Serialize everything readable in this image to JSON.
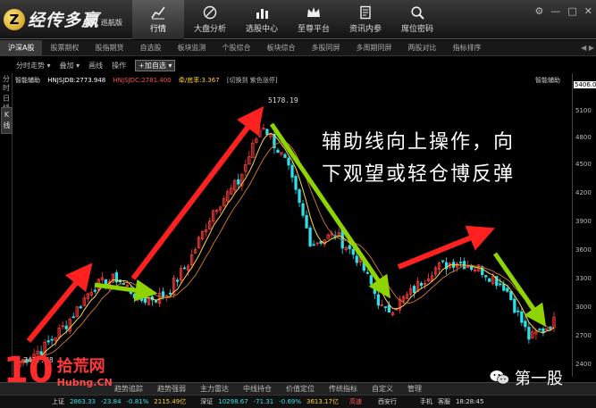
{
  "app": {
    "logo_mark": "Z",
    "name": "经传多赢",
    "edition": "巡航版"
  },
  "nav": [
    {
      "label": "行情",
      "icon": "chart-icon",
      "active": true
    },
    {
      "label": "大盘分析",
      "icon": "compass-icon"
    },
    {
      "label": "选股中心",
      "icon": "bar-chart-icon"
    },
    {
      "label": "至尊平台",
      "icon": "crown-icon"
    },
    {
      "label": "资讯内参",
      "icon": "document-icon"
    },
    {
      "label": "席位密码",
      "icon": "search-icon"
    }
  ],
  "window_buttons": [
    "⚙",
    "—",
    "□",
    "✕"
  ],
  "tabs": [
    "沪深A股",
    "股票期权",
    "股指期货",
    "自选股",
    "板块监测",
    "个股综合",
    "板块综合",
    "多股同屏",
    "多周期同屏",
    "两股对比",
    "指标排序"
  ],
  "tab_scroll": "◀ ▶",
  "toolbar": {
    "items": [
      "分时走势 ▾",
      "叠加 ▾",
      "画线",
      "操作"
    ],
    "add_button": "+加自选 ▾"
  },
  "left_strip": {
    "top_label": "分时",
    "mid_label": "日线",
    "k_tab": "K线"
  },
  "info_line": {
    "name": "智能辅助",
    "a": "HNJSJDB:2773.948",
    "b": "HNJSJDC:2781.400",
    "c": "牵/底率:3.367",
    "d": "[切换到 紫色涨停]"
  },
  "indicator_title": "智能辅助",
  "y_axis": {
    "top_value": "5406.07",
    "ticks": [
      "5100",
      "4800",
      "4500",
      "4200",
      "3900",
      "3600",
      "3300",
      "3000",
      "2700",
      "2400"
    ]
  },
  "chart_labels": {
    "high": "5178.19",
    "low": "2437.48"
  },
  "annotation": {
    "line1": "辅助线向上操作，向",
    "line2": "下观望或轻仓博反弹"
  },
  "bottom_tabs": [
    "趋势追踪",
    "趋势强弱",
    "主力雷达",
    "中线持仓",
    "价值定位",
    "传统指标",
    "自定义",
    "管理"
  ],
  "status": {
    "index1_name": "上证",
    "index1_value": "2863.33",
    "index1_change": "-23.84",
    "index1_pct": "-0.81%",
    "index1_amount": "2115.49亿",
    "index2_name": "深证",
    "index2_value": "10298.67",
    "index2_change": "-71.31",
    "index2_pct": "-0.69%",
    "index2_amount": "3613.17亿",
    "speed_label": "高速",
    "broker": "西安行",
    "mode": "手机",
    "service": "客服",
    "time": "18:28:45"
  },
  "watermark": {
    "number": "10",
    "cn": "拾荒网",
    "en": "Hubng.CN"
  },
  "wechat": {
    "name": "第一股"
  },
  "colors": {
    "up": "#ff3b3b",
    "down": "#2ee0ea",
    "arrow_up": "#ff2020",
    "arrow_down": "#8fd400",
    "accent": "#ffcc33"
  },
  "chart_data": {
    "type": "candlestick",
    "series": [
      {
        "name": "index_close_approx",
        "values": [
          2437,
          2600,
          2900,
          3300,
          3400,
          3150,
          3200,
          3600,
          4200,
          4500,
          5178,
          4700,
          3800,
          3900,
          3600,
          3000,
          3200,
          3500,
          3600,
          3500,
          3300,
          2700,
          2900
        ]
      }
    ],
    "ylim": [
      2400,
      5406.07
    ],
    "annotations": [
      {
        "type": "arrow",
        "direction": "up",
        "color": "red"
      },
      {
        "type": "arrow",
        "direction": "down",
        "color": "green"
      }
    ]
  }
}
